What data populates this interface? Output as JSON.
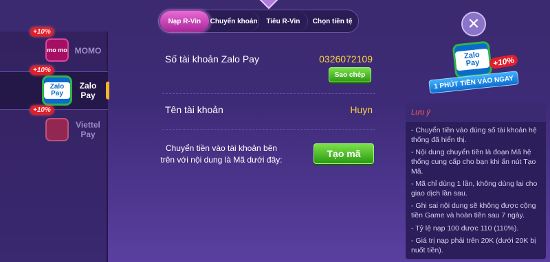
{
  "tabs": [
    {
      "label": "Nạp R-Vin",
      "active": true
    },
    {
      "label": "Chuyển khoản",
      "active": false
    },
    {
      "label": "Tiêu R-Vin",
      "active": false
    },
    {
      "label": "Chọn tiền tệ",
      "active": false
    }
  ],
  "sidebar": {
    "items": [
      {
        "label": "MOMO",
        "bonus": "+10%",
        "logo": "mo mo",
        "active": false
      },
      {
        "label": "Zalo\nPay",
        "bonus": "+10%",
        "logo": "Zalo Pay",
        "active": true
      },
      {
        "label": "Viettel\nPay",
        "bonus": "+10%",
        "logo": "",
        "active": false
      }
    ]
  },
  "main": {
    "account_number_label": "Số tài khoản Zalo Pay",
    "account_number_value": "0326072109",
    "copy_button": "Sao chép",
    "account_name_label": "Tên tài khoản",
    "account_name_value": "Huyn",
    "instruction": "Chuyển tiền vào tài khoản bên trên với nội dung là Mã dưới đây:",
    "generate_button": "Tạo mã"
  },
  "close": "✕",
  "promo": {
    "logo_text": "Zalo Pay",
    "bonus": "+10%",
    "ribbon": "1 PHÚT TIỀN VÀO NGAY"
  },
  "notes": {
    "title": "Lưu ý",
    "items": [
      "- Chuyển tiền vào đúng số tài khoản hệ thống đã hiển thị.",
      "- Nội dung chuyển tiền là đoạn Mã hệ thống cung cấp cho bạn khi ấn nút Tạo Mã.",
      "- Mã chỉ dùng 1 lần, không dùng lại cho giao dịch lần sau.",
      "- Ghi sai nội dung sẽ không được cộng tiền Game và hoàn tiền sau 7 ngày.",
      "- Tỷ lệ nạp 100 được 110 (110%).",
      "- Giá trị nạp phải trên 20K (dưới 20K bị nuốt tiền)."
    ]
  },
  "colors": {
    "accent_pink": "#c43bb5",
    "value_yellow": "#ffd23d",
    "button_green": "#3fb51c",
    "bonus_red": "#e01f2c",
    "notes_title_red": "#ff5c5c"
  }
}
